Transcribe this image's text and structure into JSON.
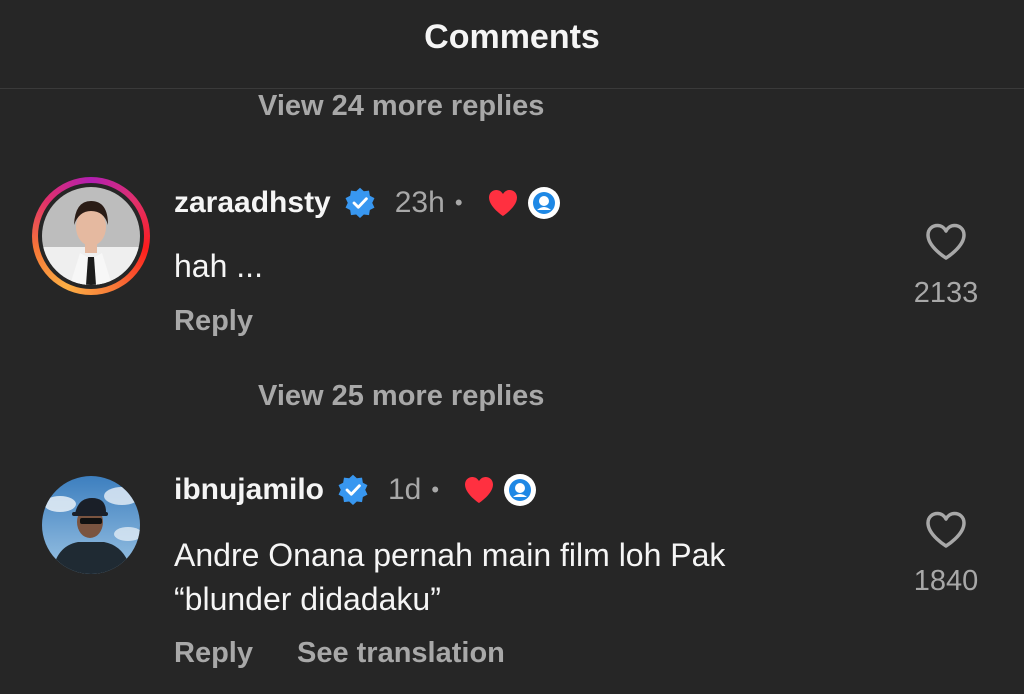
{
  "header": {
    "title": "Comments"
  },
  "threads": [
    {
      "view_more": "View 24 more replies",
      "comment": {
        "username": "zaraadhsty",
        "time": "23h",
        "dot": "•",
        "text": "hah ...",
        "reply_label": "Reply",
        "like_count": "2133",
        "has_story_ring": true
      }
    },
    {
      "view_more": "View 25 more replies",
      "comment": {
        "username": "ibnujamilo",
        "time": "1d",
        "dot": "•",
        "text_lines": [
          "Andre Onana pernah main film loh Pak",
          "“blunder didadaku”"
        ],
        "reply_label": "Reply",
        "see_translation_label": "See translation",
        "like_count": "1840",
        "has_story_ring": false
      }
    }
  ],
  "colors": {
    "background": "#262626",
    "primary_text": "#f5f5f5",
    "secondary_text": "#a8a8a8",
    "verified_blue": "#3897f0",
    "heart_red": "#ff3040"
  }
}
